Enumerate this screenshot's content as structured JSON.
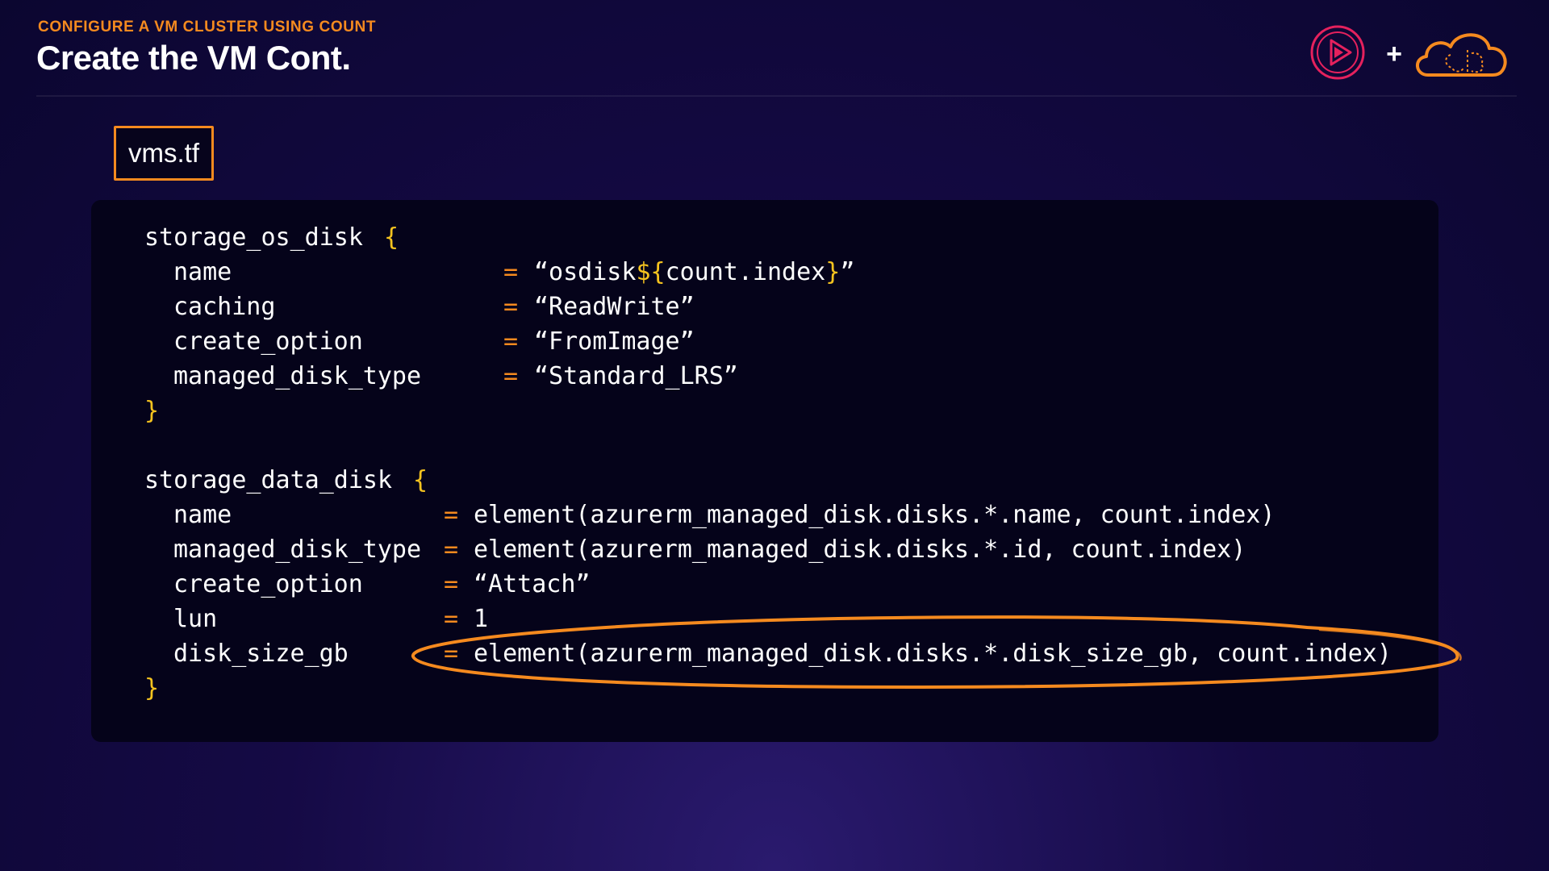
{
  "header": {
    "subtitle": "CONFIGURE A VM CLUSTER USING COUNT",
    "title": "Create the VM Cont.",
    "plus": "+"
  },
  "file_tab": {
    "label": "vms.tf"
  },
  "code": {
    "os_disk": {
      "block": "storage_os_disk",
      "open_brace": "{",
      "close_brace": "}",
      "lines": [
        {
          "key": "name",
          "eq": "=",
          "value_pre": "“osdisk",
          "value_interp": "${",
          "value_mid": "count.index",
          "value_interp_close": "}",
          "value_post": "”"
        },
        {
          "key": "caching",
          "eq": "=",
          "value": "“ReadWrite”"
        },
        {
          "key": "create_option",
          "eq": "=",
          "value": "“FromImage”"
        },
        {
          "key": "managed_disk_type",
          "eq": "=",
          "value": "“Standard_LRS”"
        }
      ]
    },
    "data_disk": {
      "block": "storage_data_disk",
      "open_brace": "{",
      "close_brace": "}",
      "lines": [
        {
          "key": "name",
          "eq": "=",
          "value": "element(azurerm_managed_disk.disks.*.name, count.index)"
        },
        {
          "key": "managed_disk_type",
          "eq": "=",
          "value": "element(azurerm_managed_disk.disks.*.id, count.index)"
        },
        {
          "key": "create_option",
          "eq": "=",
          "value": "“Attach”"
        },
        {
          "key": "lun",
          "eq": "=",
          "value": "1"
        },
        {
          "key": "disk_size_gb",
          "eq": "=",
          "value": "element(azurerm_managed_disk.disks.*.disk_size_gb, count.index)"
        }
      ]
    }
  },
  "colors": {
    "accent_orange": "#f58a1f",
    "brace_yellow": "#f5c31f",
    "pluralsight_pink": "#e5215d"
  },
  "icons": [
    "pluralsight-play-logo-icon",
    "cloud-brain-logo-icon"
  ]
}
